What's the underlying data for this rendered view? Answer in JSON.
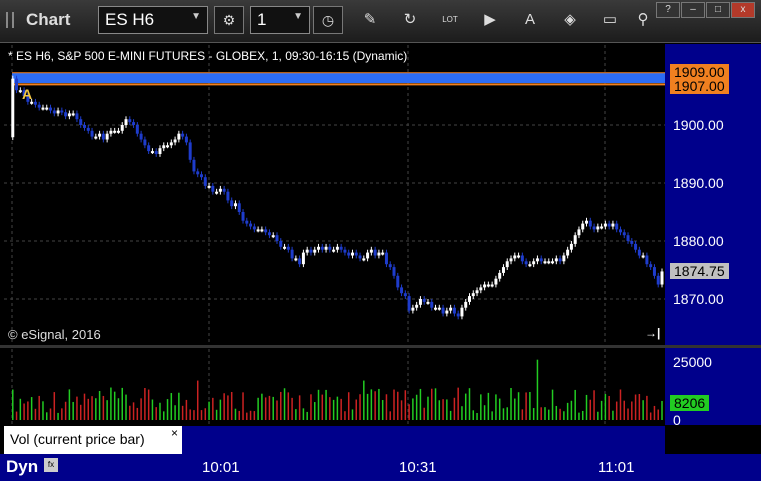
{
  "app": {
    "title": "Chart",
    "symbol": "ES H6",
    "interval": "1"
  },
  "toolbar": {
    "icons": [
      "cycle-icon",
      "clock-icon",
      "pencil-icon",
      "refresh-icon",
      "lot-icon",
      "play-icon",
      "alert-icon",
      "tag-icon",
      "message-icon",
      "pin-icon"
    ],
    "lot_label": "LOT",
    "alert_label": "A"
  },
  "window_buttons": {
    "help": "?",
    "minimize": "–",
    "maximize": "□",
    "close": "x"
  },
  "chart": {
    "symbol_line": "* ES H6, S&P 500 E-MINI FUTURES - GLOBEX, 1, 09:30-16:15 (Dynamic)",
    "copyright": "© eSignal, 2016",
    "alert_marker": "A",
    "price_ticks": [
      "1900.00",
      "1890.00",
      "1880.00",
      "1870.00"
    ],
    "upper_label": "1909.00",
    "lower_label": "1907.00",
    "current_price": "1874.75",
    "vol_ticks": [
      "25000",
      "0"
    ],
    "current_volume": "8206",
    "vol_tab_label": "Vol (current price bar)",
    "vol_tab_close": "×",
    "dyn_label": "Dyn",
    "dyn_icon": "fx",
    "time_labels": [
      "10:01",
      "10:31",
      "11:01"
    ],
    "scroll_icon": "→|",
    "colors": {
      "bear": "#1e3ccc",
      "bull": "#ffffff",
      "axis_bg": "#00008b",
      "band": "#2c6cf5",
      "label_orange": "#f08020",
      "vol_green": "#22cc22",
      "vol_red": "#cc2222",
      "price_label_bg": "#c0c0c0"
    }
  },
  "chart_data": {
    "type": "candlestick",
    "title": "* ES H6, S&P 500 E-MINI FUTURES - GLOBEX, 1, 09:30-16:15 (Dynamic)",
    "ylim": [
      1864,
      1912
    ],
    "closes": [
      1897.9,
      1908,
      1906,
      1906,
      1905,
      1904,
      1904,
      1903.5,
      1903,
      1903,
      1903,
      1902.5,
      1902,
      1902.5,
      1902.2,
      1901.5,
      1902,
      1902,
      1901,
      1900,
      1899.5,
      1899,
      1898,
      1898,
      1898.5,
      1897.5,
      1898.5,
      1899,
      1899,
      1899,
      1900,
      1901,
      1900.5,
      1900,
      1898.5,
      1897.5,
      1896.5,
      1895.5,
      1895.5,
      1895,
      1896,
      1896.5,
      1896.5,
      1897,
      1897.5,
      1898.5,
      1898,
      1897,
      1894,
      1892,
      1891.5,
      1891,
      1889.5,
      1889.5,
      1888.5,
      1888.5,
      1889,
      1888.5,
      1887,
      1886,
      1886.5,
      1885,
      1883.5,
      1883,
      1882.5,
      1882,
      1882,
      1882,
      1881.5,
      1881,
      1881,
      1880,
      1879,
      1879,
      1878.5,
      1877,
      1877,
      1876,
      1878,
      1878.5,
      1878,
      1878.5,
      1879,
      1878.5,
      1879,
      1878.5,
      1878.5,
      1879,
      1878.5,
      1878,
      1877.5,
      1878,
      1877.5,
      1877,
      1877,
      1878,
      1878.5,
      1877.5,
      1878,
      1878,
      1876,
      1875.5,
      1874,
      1872,
      1871,
      1870.5,
      1868,
      1868.5,
      1869,
      1870,
      1869.5,
      1869.5,
      1868.5,
      1868.5,
      1868.5,
      1867.5,
      1868,
      1868.5,
      1867.5,
      1867,
      1868.5,
      1869.5,
      1870.5,
      1871,
      1871.5,
      1872,
      1872.5,
      1872.5,
      1872.5,
      1873.5,
      1874.5,
      1875.5,
      1876.5,
      1877,
      1877.5,
      1877.5,
      1876.5,
      1876,
      1876,
      1876.5,
      1877,
      1876.5,
      1876.5,
      1876.5,
      1876.5,
      1877,
      1876.5,
      1877.5,
      1878.5,
      1879.5,
      1881,
      1882,
      1883,
      1883.5,
      1882.5,
      1882,
      1882.5,
      1882.5,
      1883,
      1882.5,
      1883,
      1882,
      1881.5,
      1881,
      1880,
      1879.5,
      1878.5,
      1877.5,
      1877.5,
      1876,
      1875.5,
      1874,
      1872.5,
      1874.75
    ],
    "volume_max": 25000,
    "last_volume": 8206,
    "time_labels": [
      "10:01",
      "10:31",
      "11:01"
    ]
  }
}
